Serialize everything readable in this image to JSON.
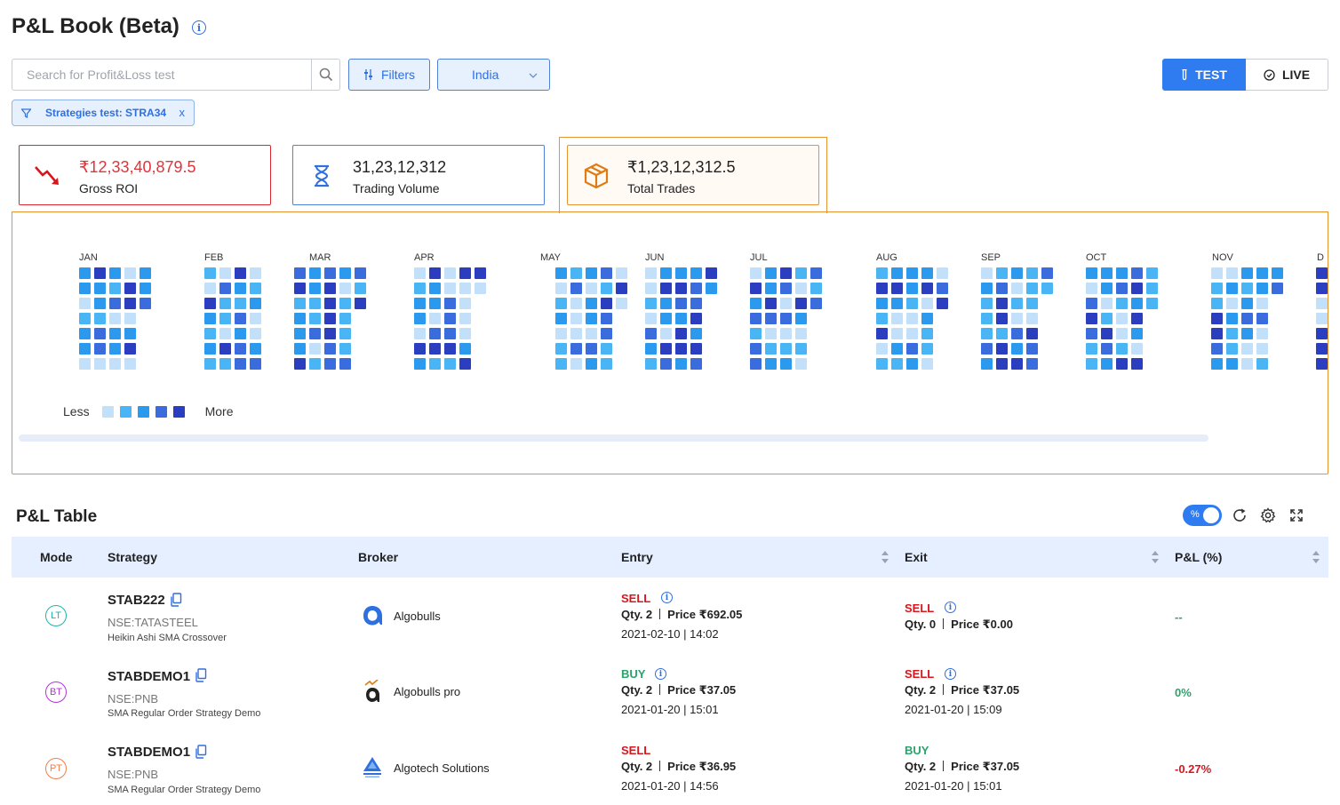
{
  "header": {
    "title": "P&L Book (Beta)"
  },
  "search": {
    "placeholder": "Search for Profit&Loss test"
  },
  "filters_label": "Filters",
  "country": "India",
  "mode": {
    "test_label": "TEST",
    "live_label": "LIVE",
    "active": "TEST"
  },
  "chip": {
    "label": "Strategies test: STRA34",
    "close": "x"
  },
  "kpis": {
    "roi": {
      "value": "₹12,33,40,879.5",
      "label": "Gross ROI",
      "color": "#e0343b"
    },
    "volume": {
      "value": "31,23,12,312",
      "label": "Trading Volume"
    },
    "trades": {
      "value": "₹1,23,12,312.5",
      "label": "Total Trades",
      "accent": "#e89331"
    }
  },
  "heatmap": {
    "months": [
      "JAN",
      "FEB",
      "MAR",
      "APR",
      "MAY",
      "JUN",
      "JUL",
      "AUG",
      "SEP",
      "OCT",
      "NOV",
      "D"
    ],
    "palette": [
      "#c3e0fa",
      "#49b5f5",
      "#2a99ee",
      "#3b6cdd",
      "#2c3ec0"
    ],
    "legend_less": "Less",
    "legend_more": "More"
  },
  "table": {
    "title": "P&L Table",
    "pct_toggle": "%",
    "columns": [
      "Mode",
      "Strategy",
      "Broker",
      "Entry",
      "Exit",
      "P&L (%)"
    ],
    "rows": [
      {
        "mode": "LT",
        "mode_color": "#1bb5a8",
        "name": "STAB222",
        "symbol": "NSE:TATASTEEL",
        "desc": "Heikin Ashi SMA Crossover",
        "broker": "Algobulls",
        "broker_icon": "algobulls-logo-icon",
        "entry": {
          "side": "SELL",
          "qty": "Qty. 2",
          "price": "Price ₹692.05",
          "time": "2021-02-10 | 14:02"
        },
        "exit": {
          "side": "SELL",
          "qty": "Qty. 0",
          "price": "Price ₹0.00",
          "time": ""
        },
        "pnl": "--",
        "pnl_color": "#2aa46a"
      },
      {
        "mode": "BT",
        "mode_color": "#b531d8",
        "name": "STABDEMO1",
        "symbol": "NSE:PNB",
        "desc": "SMA Regular Order Strategy Demo",
        "broker": "Algobulls pro",
        "broker_icon": "algobulls-pro-logo-icon",
        "entry": {
          "side": "BUY",
          "qty": "Qty. 2",
          "price": "Price ₹37.05",
          "time": "2021-01-20 | 15:01"
        },
        "exit": {
          "side": "SELL",
          "qty": "Qty. 2",
          "price": "Price ₹37.05",
          "time": "2021-01-20 | 15:09"
        },
        "pnl": "0%",
        "pnl_color": "#2aa46a"
      },
      {
        "mode": "PT",
        "mode_color": "#f07d4a",
        "name": "STABDEMO1",
        "symbol": "NSE:PNB",
        "desc": "SMA Regular Order Strategy Demo",
        "broker": "Algotech Solutions",
        "broker_icon": "algotech-logo-icon",
        "entry": {
          "side": "SELL",
          "qty": "Qty. 2",
          "price": "Price ₹36.95",
          "time": "2021-01-20 | 14:56"
        },
        "exit": {
          "side": "BUY",
          "qty": "Qty. 2",
          "price": "Price ₹37.05",
          "time": "2021-01-20 | 15:01"
        },
        "pnl": "-0.27%",
        "pnl_color": "#d7161e"
      }
    ]
  }
}
